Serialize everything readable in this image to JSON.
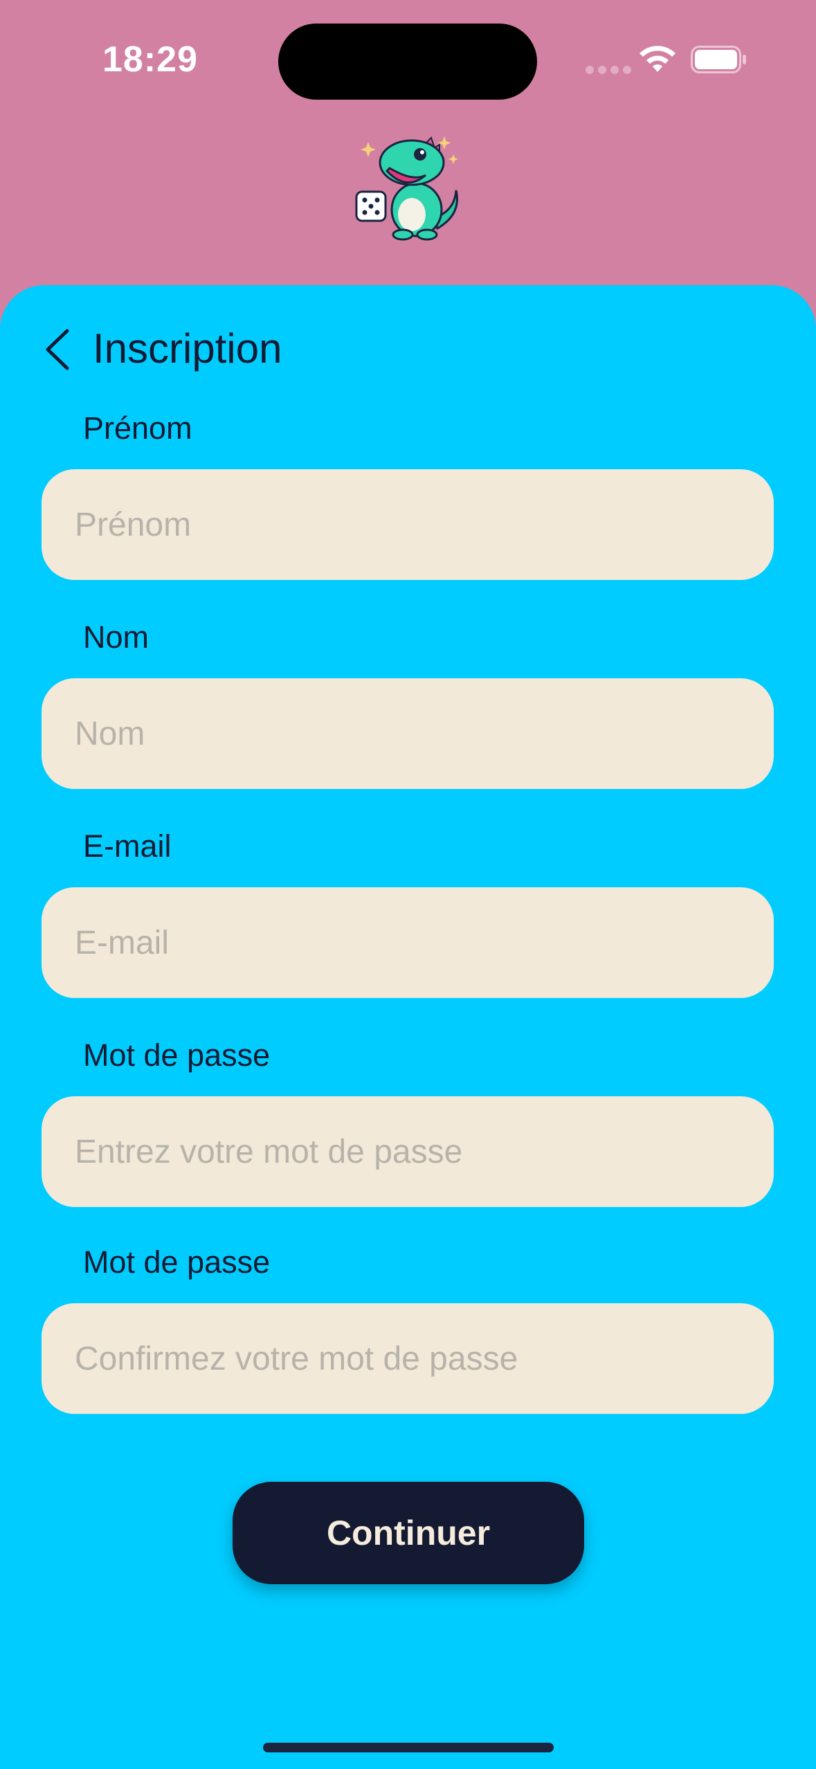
{
  "status_bar": {
    "time": "18:29",
    "icons": [
      "cellular-signal-icon",
      "wifi-icon",
      "battery-icon"
    ]
  },
  "header": {
    "logo_icon": "dinosaur-dice-mascot-icon",
    "title": "Inscription",
    "back_icon": "chevron-left-icon"
  },
  "form": {
    "first_name": {
      "label": "Prénom",
      "placeholder": "Prénom",
      "value": ""
    },
    "last_name": {
      "label": "Nom",
      "placeholder": "Nom",
      "value": ""
    },
    "email": {
      "label": "E-mail",
      "placeholder": "E-mail",
      "value": ""
    },
    "password": {
      "label": "Mot de passe",
      "placeholder": "Entrez votre mot de passe",
      "value": ""
    },
    "password_confirm": {
      "label": "Mot de passe",
      "placeholder": "Confirmez votre mot de passe",
      "value": ""
    },
    "submit_label": "Continuer"
  },
  "colors": {
    "top_background": "#d381a3",
    "panel_background": "#00ccff",
    "input_background": "#f2e9d8",
    "text_dark": "#151a33",
    "button_background": "#151a33",
    "button_text": "#f4ecdc"
  }
}
